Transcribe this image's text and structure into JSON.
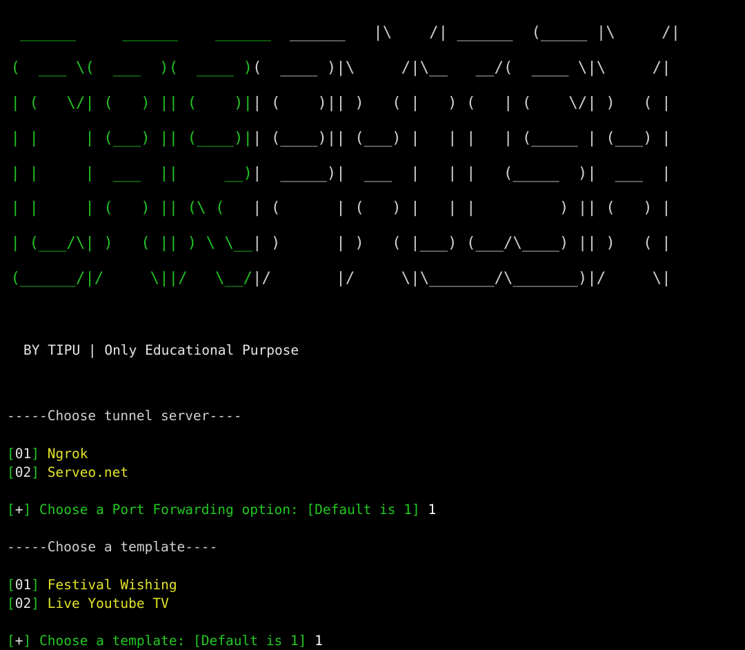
{
  "terminal": {
    "background_color": "#000000",
    "colors": {
      "green": "#22c822",
      "yellow": "#e3e32a",
      "white": "#e6e6e6",
      "banner_green": "#22c022",
      "banner_white": "#cfcfcf"
    }
  },
  "banner": {
    "tool_name": "CAMPHISH",
    "green_part": "CAM",
    "white_part": "PHISH",
    "art_rows_green": [
      "  ______     ______    ______  ",
      " (      \\   (      )  (      ) ",
      " |  (   \\/  |  (  )   |() ()| ",
      " |  |       |  (__)   | | | | ",
      " |  |        ____     | (_) | ",
      " |  |       |  (  )   | | | | ",
      " | (___/\\   |  )  (   | )  ( ",
      " (______/|  |/    \\|  |/    \\"
    ],
    "art_rows_white": [
      " ______   |\\    /| ______  (_____ |\\     /|",
      "(      )  | )  ( | |      )( (    | |   | |",
      "|  (__)   | |  | | |  (___ | (__  | (___| |",
      "|  ____)  | |  | | |_____ )| ____)|  ___  |",
      "|  (      | |  | |       )|| (    | |   | |",
      "|  )  (   | )  ( |  )   ( || )    | )   ( |",
      "|/    \\|  |/    \\| (___/ |/     \\|"
    ]
  },
  "credit_line": "BY TIPU | Only Educational Purpose",
  "sections": [
    {
      "heading": "-----Choose tunnel server----",
      "options": [
        {
          "bracket_open": "[",
          "number": "01",
          "bracket_close": "]",
          "label": "Ngrok"
        },
        {
          "bracket_open": "[",
          "number": "02",
          "bracket_close": "]",
          "label": "Serveo.net"
        }
      ],
      "prompt": {
        "marker_open": "[",
        "marker_symbol": "+",
        "marker_close": "]",
        "text": " Choose a Port Forwarding option: [Default is 1] ",
        "typed_value": "1"
      }
    },
    {
      "heading": "-----Choose a template----",
      "options": [
        {
          "bracket_open": "[",
          "number": "01",
          "bracket_close": "]",
          "label": "Festival Wishing"
        },
        {
          "bracket_open": "[",
          "number": "02",
          "bracket_close": "]",
          "label": "Live Youtube TV"
        }
      ],
      "prompt": {
        "marker_open": "[",
        "marker_symbol": "+",
        "marker_close": "]",
        "text": " Choose a template: [Default is 1] ",
        "typed_value": "1"
      }
    }
  ]
}
